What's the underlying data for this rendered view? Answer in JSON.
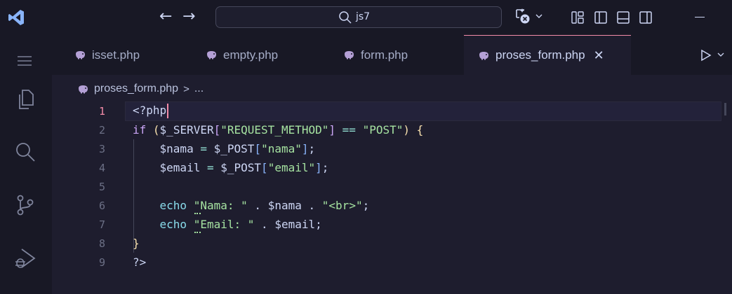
{
  "titlebar": {
    "search_text": "js7",
    "icons": [
      "vscode-logo-icon",
      "arrow-left-icon",
      "arrow-right-icon",
      "search-icon",
      "copilot-icon",
      "chevron-down-icon",
      "customize-layout-icon",
      "toggle-primary-sidebar-icon",
      "toggle-panel-icon",
      "toggle-secondary-sidebar-icon",
      "minimize-icon"
    ],
    "back_glyph": "←",
    "forward_glyph": "→"
  },
  "activitybar": {
    "items": [
      "menu-icon",
      "explorer-icon",
      "search-icon",
      "source-control-icon",
      "run-debug-icon"
    ]
  },
  "tabs": [
    {
      "label": "isset.php",
      "active": false
    },
    {
      "label": "empty.php",
      "active": false
    },
    {
      "label": "form.php",
      "active": false
    },
    {
      "label": "proses_form.php",
      "active": true,
      "close_glyph": "✕"
    }
  ],
  "breadcrumb": {
    "file": "proses_form.php",
    "separator": ">",
    "symbol": "..."
  },
  "editor": {
    "active_line": 1,
    "lines": [
      {
        "n": "1",
        "text": "<?php"
      },
      {
        "n": "2",
        "text": "if ($_SERVER[\"REQUEST_METHOD\"] == \"POST\") {"
      },
      {
        "n": "3",
        "text": "    $nama = $_POST[\"nama\"];"
      },
      {
        "n": "4",
        "text": "    $email = $_POST[\"email\"];"
      },
      {
        "n": "5",
        "text": ""
      },
      {
        "n": "6",
        "text": "    echo \"Nama: \" . $nama . \"<br>\";"
      },
      {
        "n": "7",
        "text": "    echo \"Email: \" . $email;"
      },
      {
        "n": "8",
        "text": "}"
      },
      {
        "n": "9",
        "text": "?>"
      }
    ]
  },
  "colors": {
    "background": "#1e1d2e",
    "chrome": "#181825",
    "accent": "#f38ba8",
    "keyword": "#cba6f7",
    "string": "#a6e3a1",
    "php_icon": "#b4a0d6"
  }
}
